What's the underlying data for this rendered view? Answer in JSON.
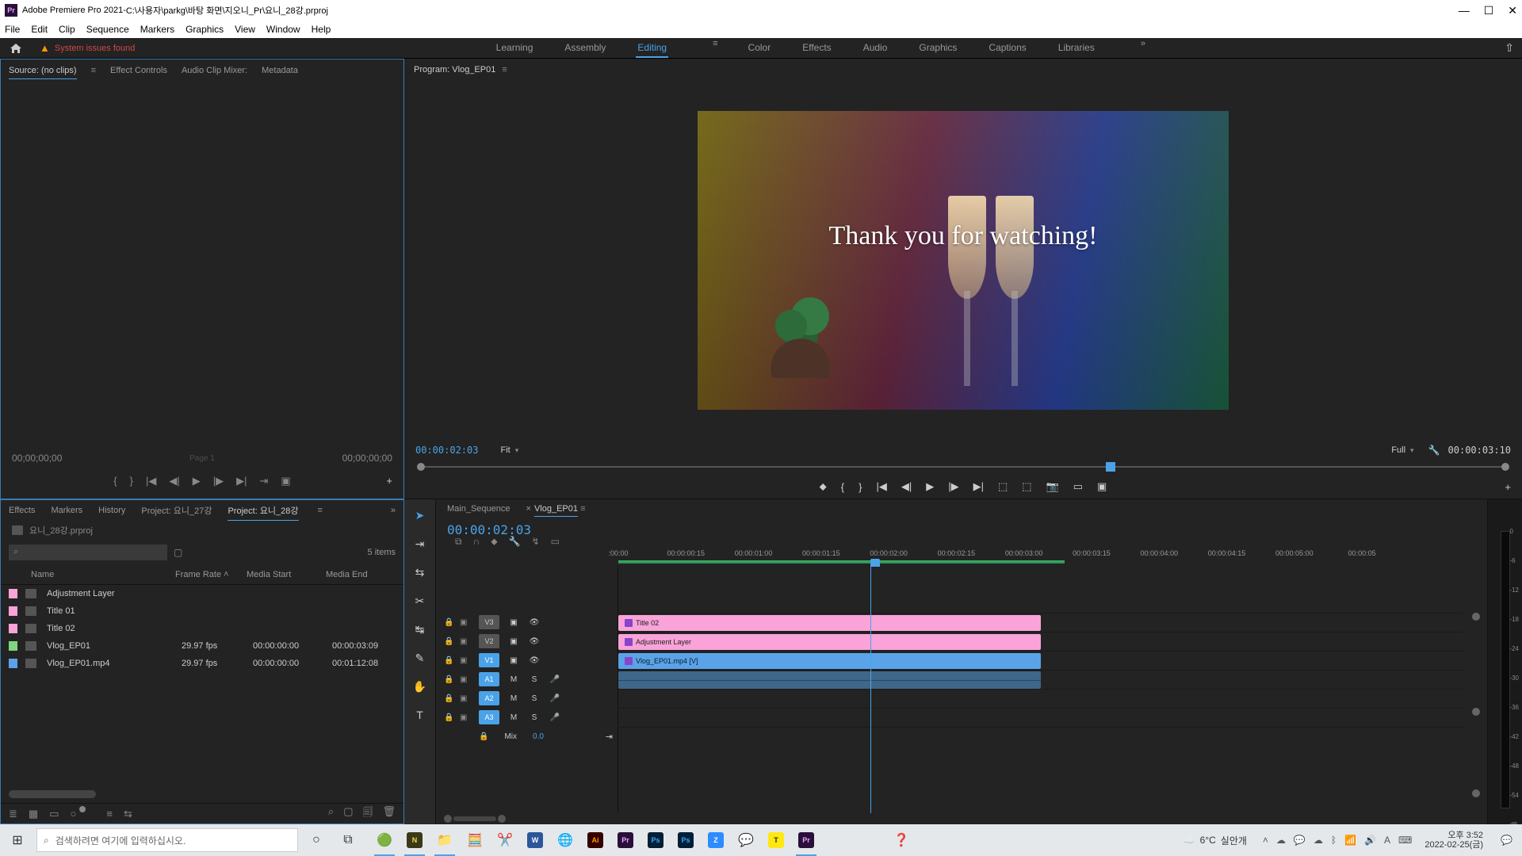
{
  "titlebar": {
    "app": "Adobe Premiere Pro 2021",
    "sep": " - ",
    "path": "C:\\사용자\\parkg\\바탕 화면\\지오니_Pr\\요니_28강.prproj"
  },
  "menu": [
    "File",
    "Edit",
    "Clip",
    "Sequence",
    "Markers",
    "Graphics",
    "View",
    "Window",
    "Help"
  ],
  "top": {
    "issues": "System issues found",
    "workspaces": [
      "Learning",
      "Assembly",
      "Editing",
      "Color",
      "Effects",
      "Audio",
      "Graphics",
      "Captions",
      "Libraries"
    ],
    "active": "Editing"
  },
  "source": {
    "tabs": [
      "Source: (no clips)",
      "Effect Controls",
      "Audio Clip Mixer:",
      "Metadata"
    ],
    "active": 0,
    "page": "Page 1",
    "tc_left": "00;00;00;00",
    "tc_right": "00;00;00;00"
  },
  "program": {
    "label": "Program: Vlog_EP01",
    "preview_text": "Thank you for watching!",
    "tc": "00:00:02:03",
    "fit": "Fit",
    "full": "Full",
    "dur": "00:00:03:10"
  },
  "project": {
    "tabs": [
      "Effects",
      "Markers",
      "History",
      "Project: 요니_27강",
      "Project: 요니_28강"
    ],
    "active": 4,
    "name": "요니_28강.prproj",
    "count": "5 items",
    "cols": {
      "name": "Name",
      "fr": "Frame Rate",
      "ms": "Media Start",
      "me": "Media End"
    },
    "items": [
      {
        "chip": "pink",
        "name": "Adjustment Layer",
        "fr": "",
        "ms": "",
        "me": ""
      },
      {
        "chip": "pink",
        "name": "Title 01",
        "fr": "",
        "ms": "",
        "me": ""
      },
      {
        "chip": "pink",
        "name": "Title 02",
        "fr": "",
        "ms": "",
        "me": ""
      },
      {
        "chip": "green",
        "name": "Vlog_EP01",
        "fr": "29.97 fps",
        "ms": "00:00:00:00",
        "me": "00:00:03:09"
      },
      {
        "chip": "blue",
        "name": "Vlog_EP01.mp4",
        "fr": "29.97 fps",
        "ms": "00:00:00:00",
        "me": "00:01:12:08"
      }
    ]
  },
  "timeline": {
    "tabs": [
      "Main_Sequence",
      "Vlog_EP01"
    ],
    "active": 1,
    "tc": "00:00:02:03",
    "ticks": [
      {
        "pos": 0,
        "label": ":00:00"
      },
      {
        "pos": 8,
        "label": "00:00:00:15"
      },
      {
        "pos": 16,
        "label": "00:00:01:00"
      },
      {
        "pos": 24,
        "label": "00:00:01:15"
      },
      {
        "pos": 32,
        "label": "00:00:02:00"
      },
      {
        "pos": 40,
        "label": "00:00:02:15"
      },
      {
        "pos": 48,
        "label": "00:00:03:00"
      },
      {
        "pos": 56,
        "label": "00:00:03:15"
      },
      {
        "pos": 64,
        "label": "00:00:04:00"
      },
      {
        "pos": 72,
        "label": "00:00:04:15"
      },
      {
        "pos": 80,
        "label": "00:00:05:00"
      },
      {
        "pos": 88,
        "label": "00:00:05"
      }
    ],
    "tracks": {
      "v3": "V3",
      "v2": "V2",
      "v1": "V1",
      "a1": "A1",
      "a2": "A2",
      "a3": "A3",
      "mix": "Mix",
      "mix_val": "0.0",
      "m": "M",
      "s": "S"
    },
    "clips": {
      "v3": "Title 02",
      "v2": "Adjustment Layer",
      "v1": "Vlog_EP01.mp4 [V]"
    }
  },
  "meters": [
    "0",
    "-6",
    "-12",
    "-18",
    "-24",
    "-30",
    "-36",
    "-42",
    "-48",
    "-54",
    "dB"
  ],
  "taskbar": {
    "search": "검색하려면 여기에 입력하십시오.",
    "weather_temp": "6°C",
    "weather_desc": "실안개",
    "time": "오후 3:52",
    "date": "2022-02-25(금)",
    "lang": "A"
  }
}
